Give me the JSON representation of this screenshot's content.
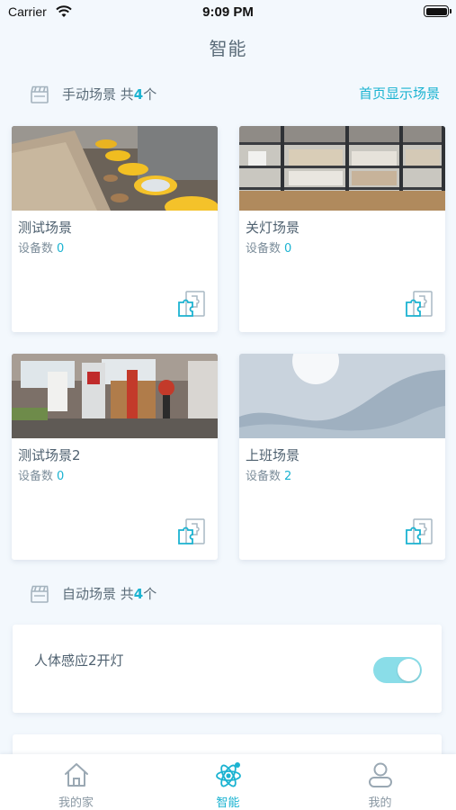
{
  "status_bar": {
    "carrier": "Carrier",
    "time": "9:09 PM"
  },
  "page": {
    "title": "智能"
  },
  "manual_section": {
    "label": "手动场景 共",
    "count": "4",
    "suffix": "个",
    "right_link": "首页显示场景"
  },
  "scenes": [
    {
      "name": "测试场景",
      "device_label": "设备数",
      "device_count": "0",
      "image": "workshop-photo"
    },
    {
      "name": "关灯场景",
      "device_label": "设备数",
      "device_count": "0",
      "image": "shelves-photo"
    },
    {
      "name": "测试场景2",
      "device_label": "设备数",
      "device_count": "0",
      "image": "gym-photo"
    },
    {
      "name": "上班场景",
      "device_label": "设备数",
      "device_count": "2",
      "image": "placeholder-landscape"
    }
  ],
  "auto_section": {
    "label": "自动场景 共",
    "count": "4",
    "suffix": "个"
  },
  "auto_scenes": [
    {
      "name": "人体感应2开灯",
      "enabled": true
    }
  ],
  "tabbar": {
    "items": [
      {
        "label": "我的家",
        "icon": "home-icon",
        "active": false
      },
      {
        "label": "智能",
        "icon": "atom-icon",
        "active": true
      },
      {
        "label": "我的",
        "icon": "user-icon",
        "active": false
      }
    ]
  },
  "colors": {
    "accent": "#1bb3d1",
    "text": "#5b6c79",
    "background": "#f3f8fd",
    "toggle_on": "#8adde8"
  }
}
